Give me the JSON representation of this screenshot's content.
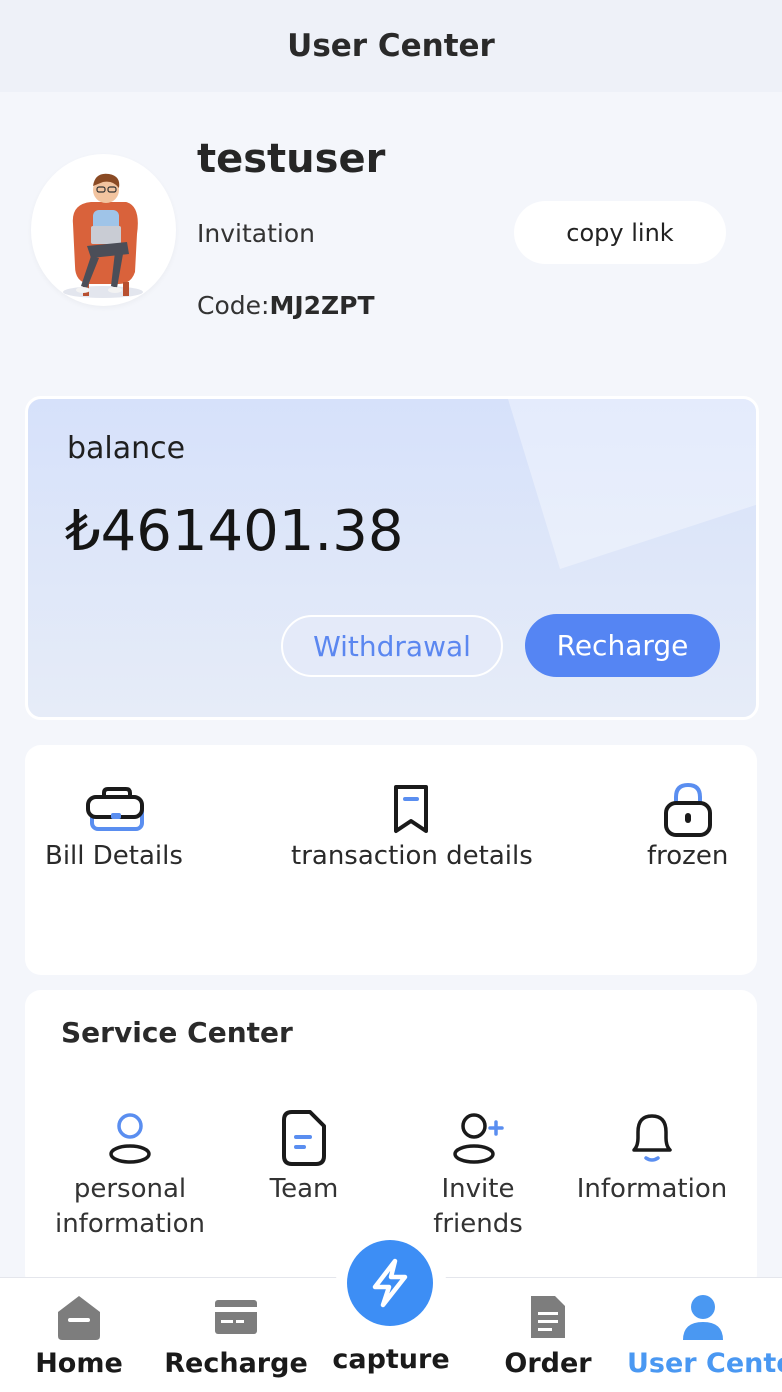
{
  "header": {
    "title": "User Center"
  },
  "profile": {
    "username": "testuser",
    "invitation_label": "Invitation",
    "code_prefix": "Code:",
    "code": "MJ2ZPT",
    "copy_button": "copy link",
    "avatar_icon": "avatar-illustration"
  },
  "balance": {
    "label": "balance",
    "amount": "₺461401.38",
    "withdraw_button": "Withdrawal",
    "recharge_button": "Recharge"
  },
  "quick_actions": [
    {
      "label": "Bill Details",
      "icon": "wallet-icon"
    },
    {
      "label": "transaction details",
      "icon": "bookmark-icon"
    },
    {
      "label": "frozen",
      "icon": "lock-icon"
    }
  ],
  "service_center": {
    "title": "Service Center",
    "items": [
      {
        "label": "personal information",
        "icon": "person-icon"
      },
      {
        "label": "Team",
        "icon": "document-icon"
      },
      {
        "label": "Invite friends",
        "icon": "add-user-icon"
      },
      {
        "label": "Information",
        "icon": "bell-icon"
      }
    ]
  },
  "tabbar": {
    "items": [
      {
        "label": "Home",
        "icon": "home-icon"
      },
      {
        "label": "Recharge",
        "icon": "card-icon"
      },
      {
        "label": "capture",
        "icon": "lightning-icon"
      },
      {
        "label": "Order",
        "icon": "order-doc-icon"
      },
      {
        "label": "User Center",
        "icon": "user-icon",
        "active": true
      }
    ]
  },
  "colors": {
    "accent": "#5585f3",
    "tab_active": "#4a98f2",
    "capture": "#3d8ef5"
  }
}
